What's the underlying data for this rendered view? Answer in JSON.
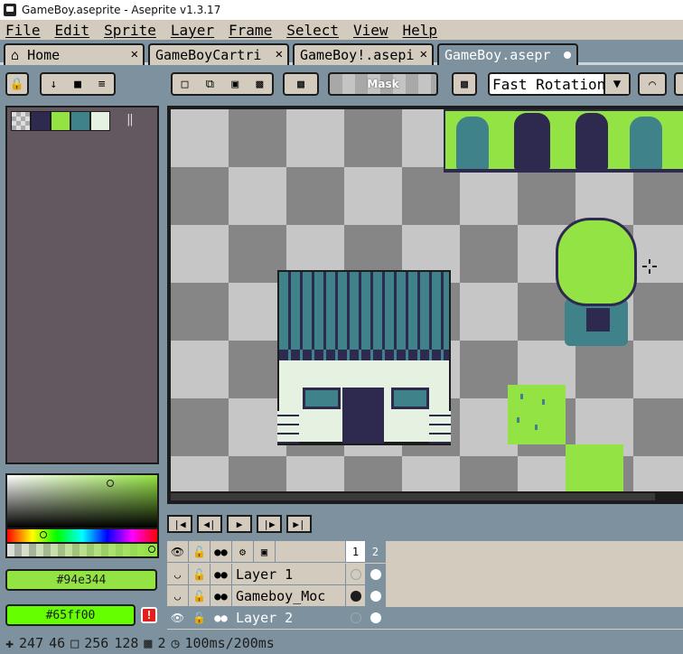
{
  "window": {
    "title": "GameBoy.aseprite - Aseprite v1.3.17"
  },
  "menu": [
    "File",
    "Edit",
    "Sprite",
    "Layer",
    "Frame",
    "Select",
    "View",
    "Help"
  ],
  "tabs": [
    {
      "label": "Home",
      "icon": "home-icon",
      "active": false
    },
    {
      "label": "GameBoyCartri",
      "active": false
    },
    {
      "label": "GameBoy!.asepi",
      "active": false
    },
    {
      "label": "GameBoy.asepr",
      "active": true,
      "modified": true
    }
  ],
  "toolbar": {
    "mask_label": "Mask",
    "rotation_algorithm": "Fast Rotation"
  },
  "palette": {
    "colors": [
      "#c0c0c0",
      "#2e2a4f",
      "#94e344",
      "#3f8289",
      "#e5f2e2"
    ]
  },
  "colors": {
    "foreground_hex": "#94e344",
    "background_hex": "#65ff00",
    "fg_swatch": "#94e344",
    "bg_swatch": "#65ff00",
    "warning": "!"
  },
  "timeline": {
    "frames": [
      "1",
      "2"
    ],
    "layers": [
      {
        "name": "Layer 1",
        "visible": false,
        "locked": false
      },
      {
        "name": "Gameboy_Moc",
        "visible": false,
        "locked": false
      },
      {
        "name": "Layer 2",
        "visible": true,
        "locked": false
      }
    ]
  },
  "status": {
    "cursor_x": "247",
    "cursor_y": "46",
    "sprite_w": "256",
    "sprite_h": "128",
    "frame": "2",
    "duration": "100ms/200ms"
  }
}
